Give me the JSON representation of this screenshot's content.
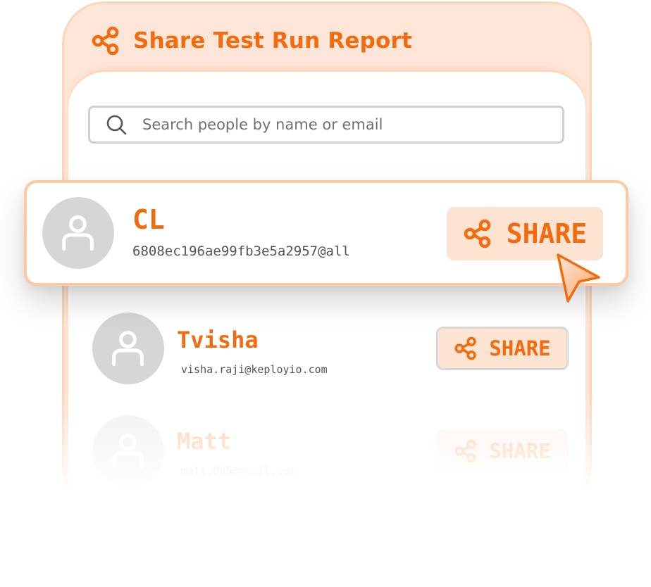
{
  "header": {
    "title": "Share Test Run Report",
    "icon": "share-icon"
  },
  "search": {
    "placeholder": "Search people by name or email",
    "icon": "search-icon"
  },
  "people": [
    {
      "name": "CL",
      "email": "6808ec196ae99fb3e5a2957@all",
      "share_label": "SHARE",
      "highlighted": true
    },
    {
      "name": "Tvisha",
      "email": "visha.raji@keployio.com",
      "share_label": "SHARE"
    },
    {
      "name": "Matt",
      "email": "matt.005@gmail.com",
      "share_label": "SHARE"
    }
  ],
  "colors": {
    "accent": "#f26b0f",
    "panel_bg": "#fde6d7",
    "button_bg": "#fde3d2",
    "avatar_bg": "#d6d6d6"
  }
}
